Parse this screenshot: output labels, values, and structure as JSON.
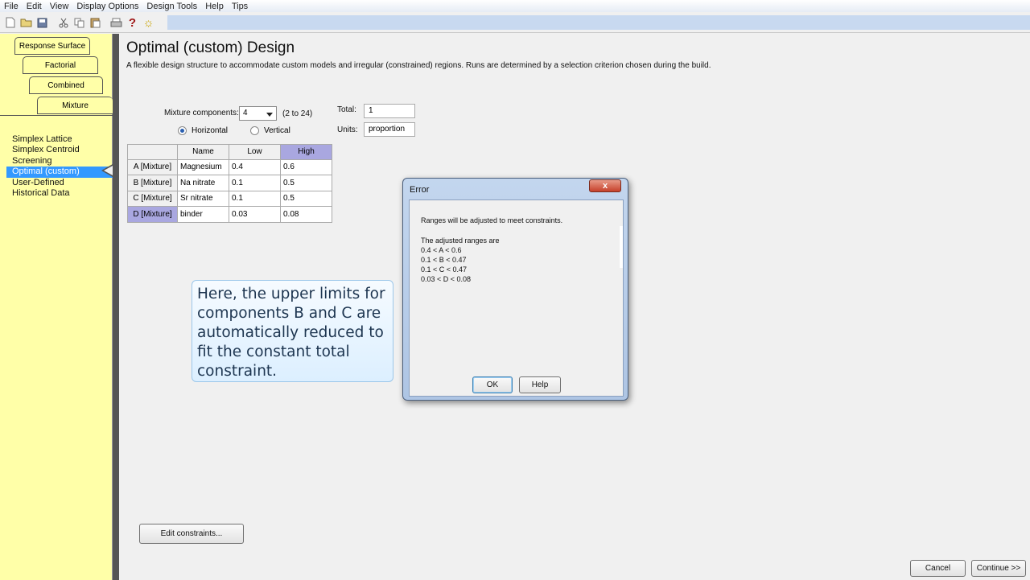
{
  "menu": [
    "File",
    "Edit",
    "View",
    "Display Options",
    "Design Tools",
    "Help",
    "Tips"
  ],
  "toolbar_icons": [
    "new-file-icon",
    "open-folder-icon",
    "save-icon",
    "cut-icon",
    "copy-icon",
    "paste-icon",
    "print-icon",
    "help-question-icon",
    "tip-bulb-icon"
  ],
  "toolbar_glyphs": {
    "help": "?",
    "tip": "☼"
  },
  "sidebar": {
    "tabs": [
      "Response Surface",
      "Factorial",
      "Combined",
      "Mixture"
    ],
    "items": [
      "Simplex Lattice",
      "Simplex Centroid",
      "Screening",
      "Optimal (custom)",
      "User-Defined",
      "Historical Data"
    ],
    "selected": "Optimal (custom)"
  },
  "main": {
    "title": "Optimal (custom) Design",
    "description": "A flexible design structure to accommodate custom models and irregular (constrained) regions.  Runs are determined by a selection criterion chosen during the build.",
    "components_label": "Mixture components:",
    "components_value": "4",
    "components_range": "(2 to 24)",
    "total_label": "Total:",
    "total_value": "1",
    "units_label": "Units:",
    "units_value": "proportion",
    "orientation": {
      "horizontal": "Horizontal",
      "vertical": "Vertical",
      "selected": "Horizontal"
    },
    "table": {
      "headers": [
        "",
        "Name",
        "Low",
        "High"
      ],
      "rows": [
        {
          "id": "A [Mixture]",
          "name": "Magnesium",
          "low": "0.4",
          "high": "0.6"
        },
        {
          "id": "B [Mixture]",
          "name": "Na nitrate",
          "low": "0.1",
          "high": "0.5"
        },
        {
          "id": "C [Mixture]",
          "name": "Sr nitrate",
          "low": "0.1",
          "high": "0.5"
        },
        {
          "id": "D [Mixture]",
          "name": "binder",
          "low": "0.03",
          "high": "0.08"
        }
      ]
    },
    "edit_constraints": "Edit constraints...",
    "cancel": "Cancel",
    "continue": "Continue >>"
  },
  "callout": {
    "lines": [
      "Here, the upper limits for",
      "components B and C are",
      "automatically reduced to",
      "fit the constant total",
      "constraint."
    ]
  },
  "dialog": {
    "title": "Error",
    "close_glyph": "x",
    "message": "Ranges will be adjusted to meet constraints.",
    "ranges_header": "The adjusted ranges are",
    "ranges": [
      "0.4 < A < 0.6",
      "0.1 < B < 0.47",
      "0.1 < C < 0.47",
      "0.03 < D < 0.08"
    ],
    "ok": "OK",
    "help": "Help"
  }
}
